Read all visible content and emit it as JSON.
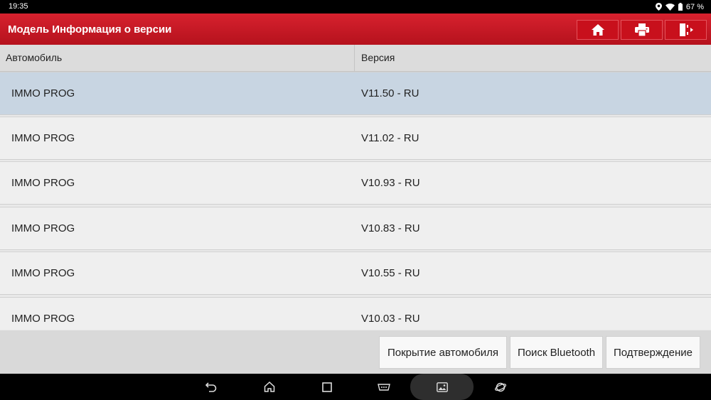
{
  "status_bar": {
    "time": "19:35",
    "battery": "67 %"
  },
  "header": {
    "title": "Модель Информация о версии"
  },
  "table": {
    "columns": [
      "Автомобиль",
      "Версия"
    ],
    "rows": [
      {
        "vehicle": "IMMO PROG",
        "version": "V11.50 - RU"
      },
      {
        "vehicle": "IMMO PROG",
        "version": "V11.02 - RU"
      },
      {
        "vehicle": "IMMO PROG",
        "version": "V10.93 - RU"
      },
      {
        "vehicle": "IMMO PROG",
        "version": "V10.83 - RU"
      },
      {
        "vehicle": "IMMO PROG",
        "version": "V10.55 - RU"
      },
      {
        "vehicle": "IMMO PROG",
        "version": "V10.03 - RU"
      }
    ]
  },
  "actions": {
    "coverage": "Покрытие автомобиля",
    "bluetooth": "Поиск Bluetooth",
    "confirm": "Подтверждение"
  },
  "icons": {
    "header": [
      "home-icon",
      "print-icon",
      "exit-icon"
    ],
    "nav": [
      "back-icon",
      "home-icon",
      "recents-icon",
      "vci-icon",
      "gallery-icon",
      "browser-icon"
    ]
  },
  "colors": {
    "header_red": "#c8101c",
    "selected_row": "#c8d5e2"
  }
}
